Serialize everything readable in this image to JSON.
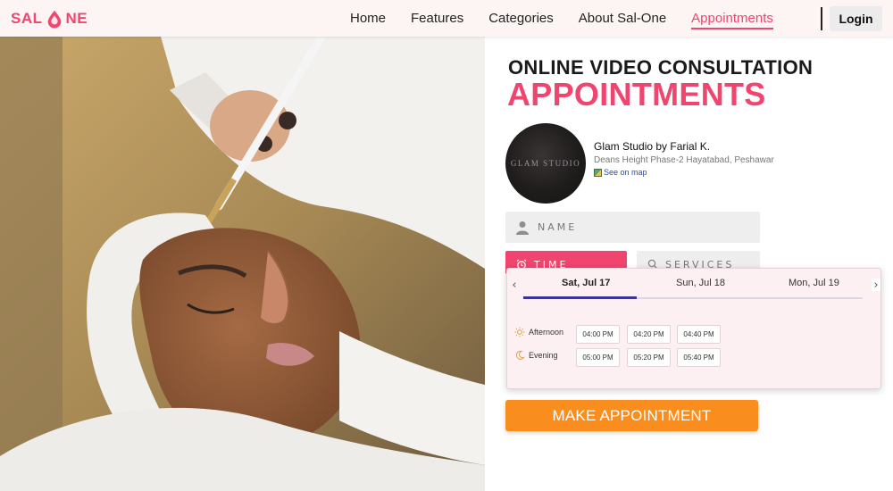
{
  "logo": {
    "text_left": "SAL",
    "text_right": "NE"
  },
  "nav": {
    "items": [
      {
        "label": "Home"
      },
      {
        "label": "Features"
      },
      {
        "label": "Categories"
      },
      {
        "label": "About Sal-One"
      },
      {
        "label": "Appointments",
        "active": true
      }
    ],
    "login_label": "Login"
  },
  "hero": {
    "image": "woman receiving a facial mask treatment with a brush"
  },
  "heading": {
    "line1": "ONLINE VIDEO CONSULTATION",
    "line2": "APPOINTMENTS"
  },
  "studio": {
    "logo_text": "GLAM STUDIO",
    "name": "Glam Studio by Farial K.",
    "address": "Deans Height Phase-2 Hayatabad, Peshawar",
    "map_link": "See on map"
  },
  "form": {
    "name_placeholder": "NAME",
    "time_tab": "TIME",
    "services_tab": "SERVICES"
  },
  "schedule": {
    "days": [
      {
        "label": "Sat, Jul 17",
        "active": true
      },
      {
        "label": "Sun, Jul 18"
      },
      {
        "label": "Mon, Jul 19"
      }
    ],
    "groups": [
      {
        "label": "Afternoon",
        "icon": "sun-icon",
        "slots": [
          "04:00 PM",
          "04:20 PM",
          "04:40 PM"
        ]
      },
      {
        "label": "Evening",
        "icon": "moon-icon",
        "slots": [
          "05:00 PM",
          "05:20 PM",
          "05:40 PM"
        ]
      }
    ]
  },
  "cta": {
    "label": "MAKE APPOINTMENT"
  },
  "colors": {
    "brand": "#f0456e",
    "cta": "#f98e1e",
    "indicator": "#3e3491"
  }
}
